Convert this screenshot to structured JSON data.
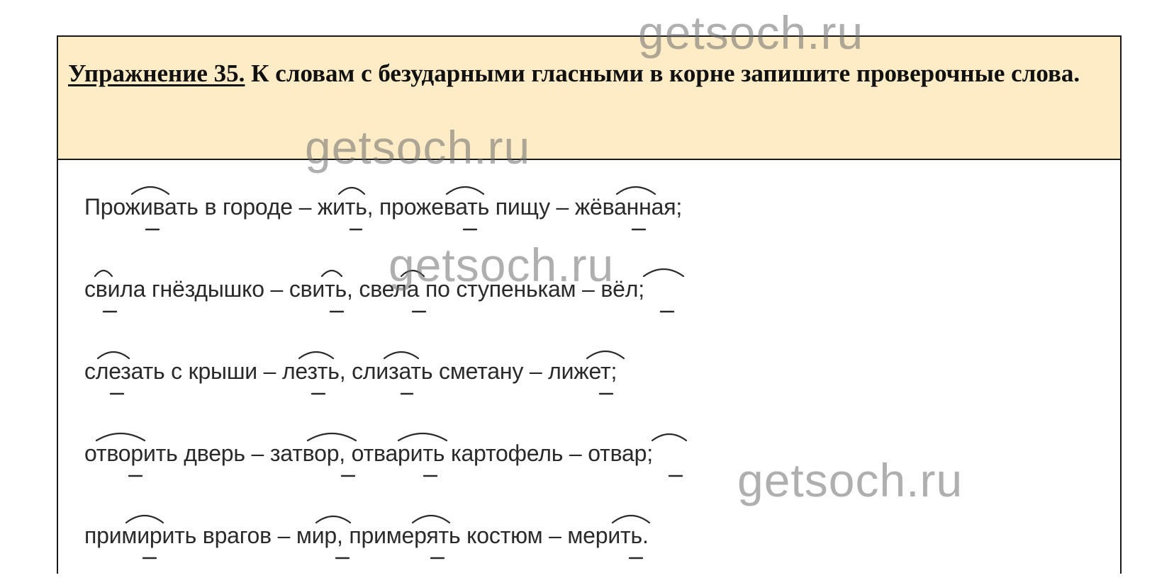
{
  "exercise": {
    "number_label": "Упражнение 35.",
    "instruction": "К словам с безударными гласными в корне запишите проверочные слова."
  },
  "answer_lines": [
    "Проживать в городе – жить, прожевать пищу – жёванная;",
    "свила гнёздышко – свить, свела по ступенькам – вёл;",
    "слезать с крыши – лезть, слизать сметану – лижет;",
    "отворить дверь – затвор, отварить картофель – отвар;",
    "примирить врагов – мир, примерять костюм – мерить."
  ],
  "watermark": "getsoch.ru"
}
